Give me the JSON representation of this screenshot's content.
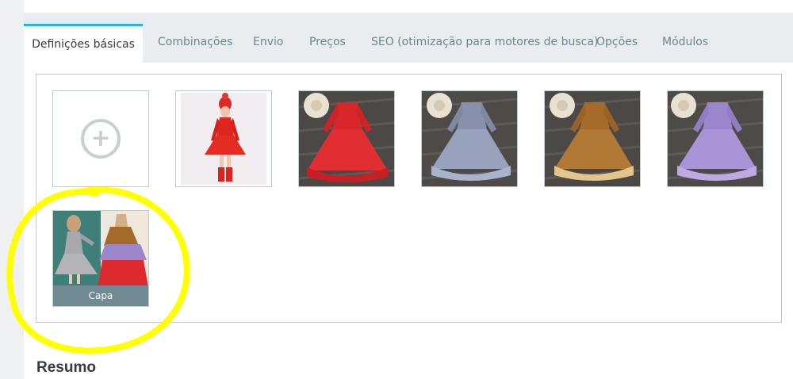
{
  "tabs": [
    {
      "label": "Definições básicas",
      "active": true
    },
    {
      "label": "Combinações"
    },
    {
      "label": "Envio"
    },
    {
      "label": "Preços"
    },
    {
      "label": "SEO (otimização para motores de busca)"
    },
    {
      "label": "Opções"
    },
    {
      "label": "Módulos"
    }
  ],
  "images": {
    "add_icon": "plus-circle-icon",
    "add_symbol": "+",
    "thumbnails": [
      {
        "name": "red-dress-model-photo",
        "color": "#e2261f"
      },
      {
        "name": "red-knit-dress-photo",
        "color": "#d72a2c"
      },
      {
        "name": "blue-grey-knit-dress-photo",
        "color": "#8d97b3"
      },
      {
        "name": "brown-knit-dress-photo",
        "color": "#a9702e"
      },
      {
        "name": "lavender-knit-dress-photo",
        "color": "#a48fd2"
      },
      {
        "name": "cover-collage-photo",
        "cover": true
      }
    ],
    "cover_label": "Capa"
  },
  "summary": {
    "title": "Resumo"
  },
  "colors": {
    "accent": "#25b9d7",
    "highlight": "#ffff00"
  }
}
